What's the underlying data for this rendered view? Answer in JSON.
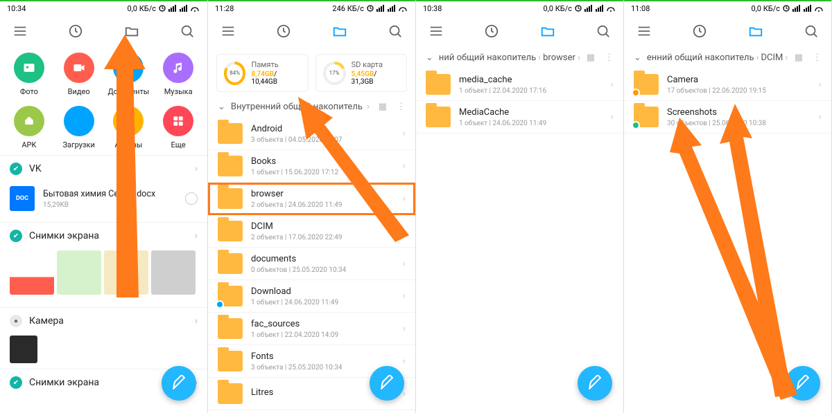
{
  "panels": [
    {
      "time": "10:34",
      "net": "0,0 КБ/с",
      "categories": [
        {
          "label": "Фото",
          "cls": "c-photo",
          "icon": "photo"
        },
        {
          "label": "Видео",
          "cls": "c-video",
          "icon": "video"
        },
        {
          "label": "Документы",
          "cls": "c-doc",
          "icon": "doc"
        },
        {
          "label": "Музыка",
          "cls": "c-music",
          "icon": "music"
        },
        {
          "label": "APK",
          "cls": "c-apk",
          "icon": "apk"
        },
        {
          "label": "Загрузки",
          "cls": "c-dl",
          "icon": "dl"
        },
        {
          "label": "Архивы",
          "cls": "c-arch",
          "icon": "arch"
        },
        {
          "label": "Еще",
          "cls": "c-more",
          "icon": "more"
        }
      ],
      "vk": "VK",
      "doc": {
        "name": "Бытовая химия Семья.docx",
        "size": "15,29KB"
      },
      "shots": "Снимки экрана",
      "camera": "Камера",
      "shots2": "Снимки экрана"
    },
    {
      "time": "11:28",
      "net": "246 КБ/с",
      "stor1": {
        "pct": "84%",
        "ring": 84,
        "color": "#ffb300",
        "label": "Память",
        "used": "8,74GB",
        "total": "10,44GB"
      },
      "stor2": {
        "pct": "17%",
        "ring": 17,
        "color": "#ffcf33",
        "label": "SD карта",
        "used": "5,45GB",
        "total": "31,3GB"
      },
      "crumb": "Внутренний общий накопитель",
      "folders": [
        {
          "n": "Android",
          "m": "3 объекта | 04.05.2020 10:07"
        },
        {
          "n": "Books",
          "m": "1 объект | 15.06.2020 17:12"
        },
        {
          "n": "browser",
          "m": "2 объекта | 24.06.2020 11:49",
          "hl": true
        },
        {
          "n": "DCIM",
          "m": "2 объекта | 17.06.2020 22:49"
        },
        {
          "n": "documents",
          "m": "0 объектов | 25.05.2020 10:34"
        },
        {
          "n": "Download",
          "m": "1 объект | 24.06.2020 11:49",
          "badge": "#00a4ff"
        },
        {
          "n": "fac_sources",
          "m": "1 объект | 22.04.2020 14:09"
        },
        {
          "n": "Fonts",
          "m": "3 объекта | 25.05.2020 10:34"
        },
        {
          "n": "Litres",
          "m": ""
        }
      ]
    },
    {
      "time": "10:38",
      "net": "0,0 КБ/с",
      "crumb_a": "ний общий накопитель",
      "crumb_b": "browser",
      "folders": [
        {
          "n": "media_cache",
          "m": "1 объект | 22.04.2020 17:16"
        },
        {
          "n": "MediaCache",
          "m": "1 объект | 24.06.2020 11:49"
        }
      ]
    },
    {
      "time": "11:08",
      "net": "0,0 КБ/с",
      "crumb_a": "енний общий накопитель",
      "crumb_b": "DCIM",
      "folders": [
        {
          "n": "Camera",
          "m": "17 объектов | 22.06.2020 19:15",
          "badge": "#ff9a00"
        },
        {
          "n": "Screenshots",
          "m": "30 объектов | 25.06.2020 10:38",
          "badge": "#1cc183"
        }
      ]
    }
  ]
}
